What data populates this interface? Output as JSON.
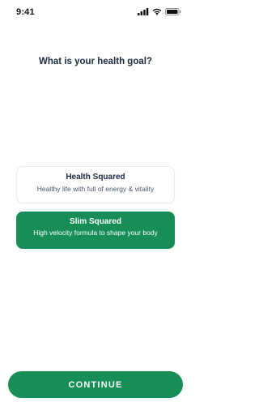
{
  "status_bar": {
    "time": "9:41",
    "icons": [
      "cellular-signal-icon",
      "wifi-icon",
      "battery-icon"
    ]
  },
  "question": "What is your health goal?",
  "options": [
    {
      "title": "Health Squared",
      "subtitle": "Healthy life with full of energy & vitality",
      "selected": false
    },
    {
      "title": "Slim Squared",
      "subtitle": "High velocity formula to shape your body",
      "selected": true
    }
  ],
  "continue_label": "CONTINUE",
  "colors": {
    "accent": "#168e55",
    "text_dark": "#1c2a44",
    "card_border": "#e9ecef"
  }
}
